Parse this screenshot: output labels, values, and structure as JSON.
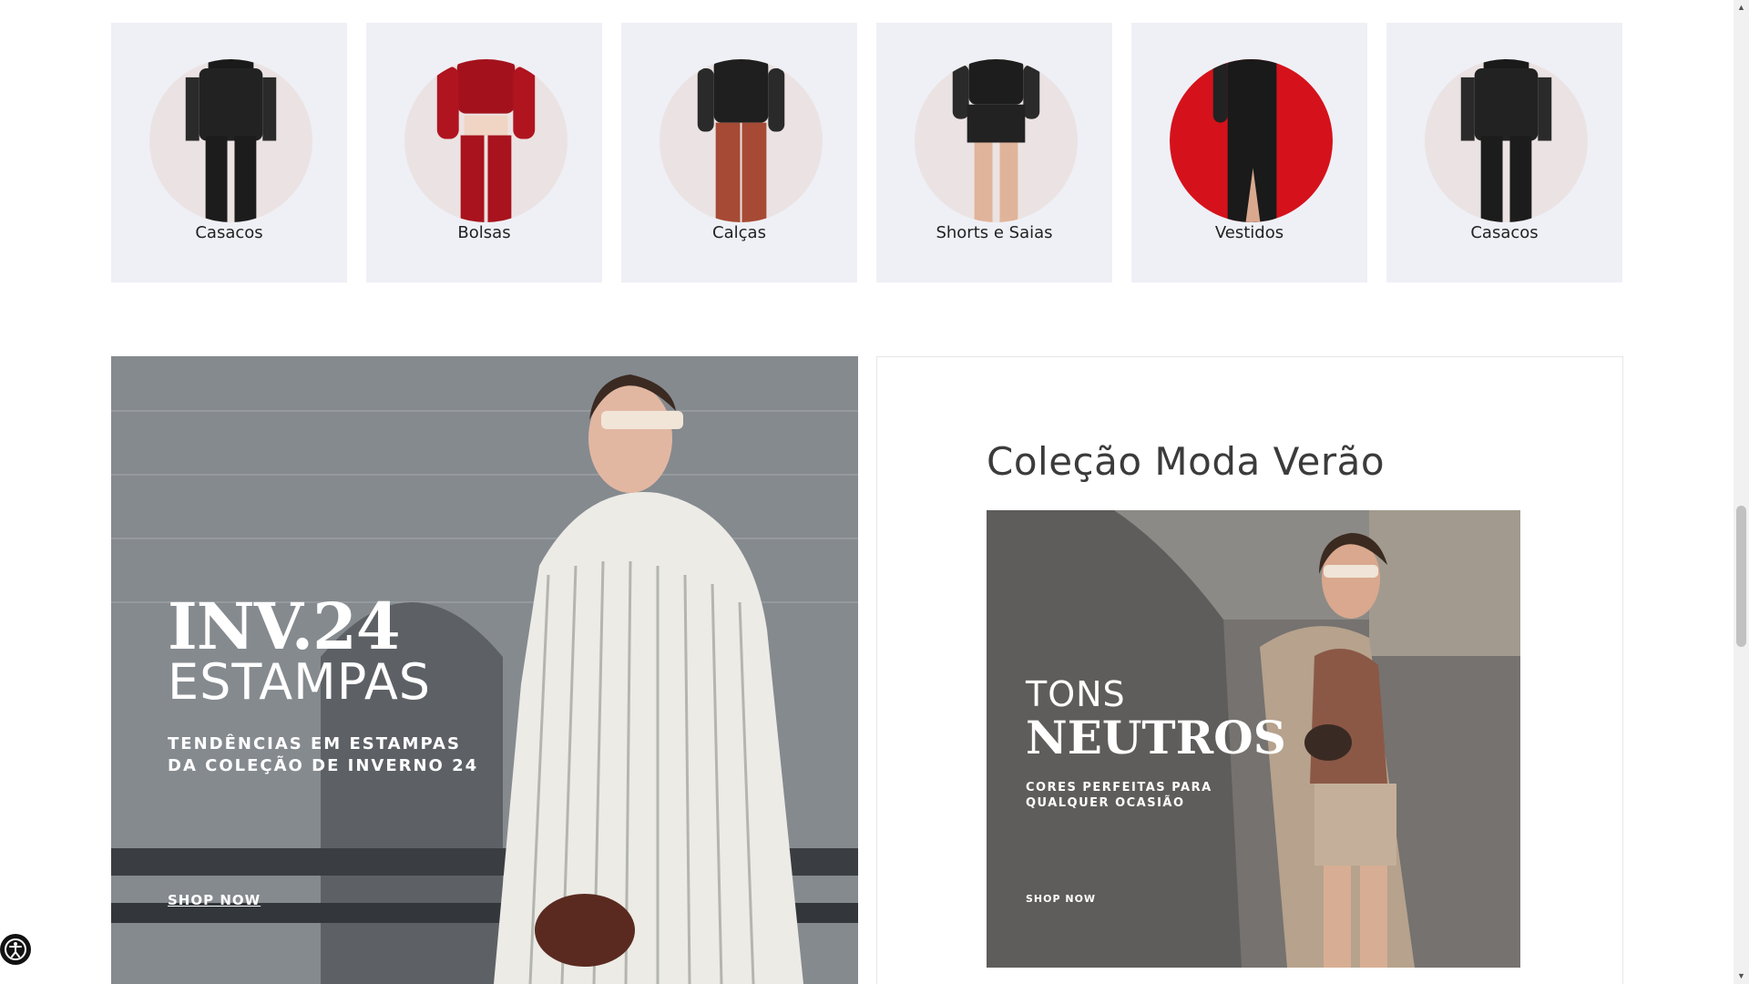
{
  "categories": [
    {
      "label": "Casacos",
      "theme": "black-outfit"
    },
    {
      "label": "Bolsas",
      "theme": "red-outfit"
    },
    {
      "label": "Calças",
      "theme": "rust-pants"
    },
    {
      "label": "Shorts e Saias",
      "theme": "black-skirt"
    },
    {
      "label": "Vestidos",
      "theme": "black-dress-red-bg"
    },
    {
      "label": "Casacos",
      "theme": "black-outfit"
    }
  ],
  "banner_left": {
    "title": "INV.24",
    "subtitle": "ESTAMPAS",
    "description_line1": "TENDÊNCIAS EM ESTAMPAS",
    "description_line2": "DA COLEÇÃO DE INVERNO 24",
    "cta": "SHOP NOW"
  },
  "collection": {
    "heading": "Coleção Moda Verão",
    "banner": {
      "line1": "TONS",
      "line2": "NEUTROS",
      "description_line1": "CORES PERFEITAS PARA",
      "description_line2": "QUALQUER OCASIÃO",
      "cta": "SHOP NOW"
    }
  },
  "scrollbar": {
    "up_icon": "▲",
    "down_icon": "▼"
  },
  "colors": {
    "card_bg": "#eff0f6",
    "circle_bg": "#e9e1e1",
    "accent_red": "#d5121b"
  }
}
